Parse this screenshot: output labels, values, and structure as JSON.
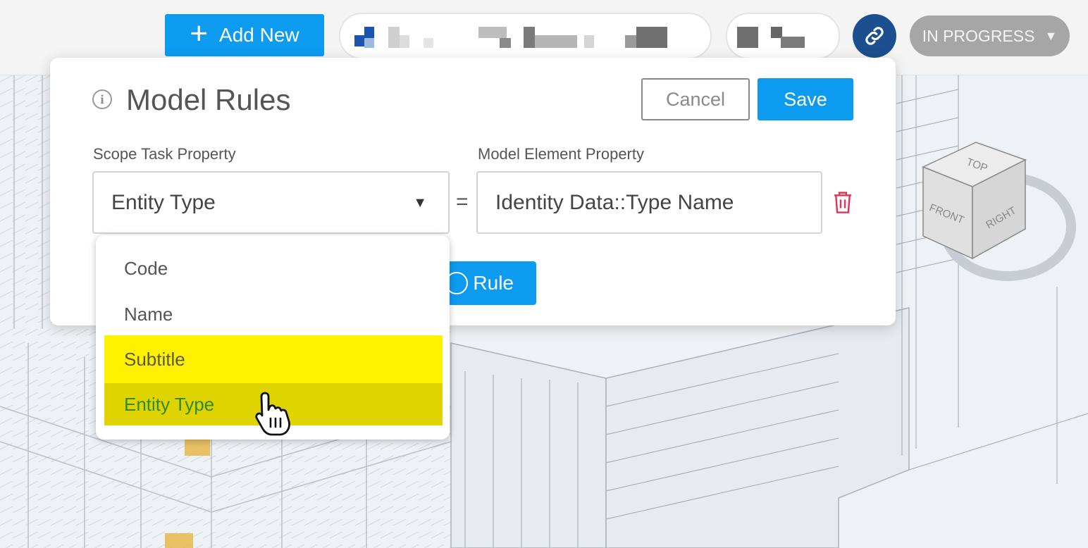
{
  "topbar": {
    "add_new_label": "Add New",
    "status_label": "IN PROGRESS",
    "colors": {
      "primary": "#0d9bf0",
      "link": "#1c4f8f",
      "status": "#a6a6a6"
    }
  },
  "modal": {
    "title": "Model Rules",
    "cancel_label": "Cancel",
    "save_label": "Save",
    "scope_label": "Scope Task Property",
    "model_label": "Model Element Property",
    "scope_value": "Entity Type",
    "equals": "=",
    "model_value": "Identity Data::Type Name",
    "add_rule_label": "Rule"
  },
  "dropdown": {
    "options": [
      "Code",
      "Name",
      "Subtitle",
      "Entity Type"
    ],
    "highlight_color": "#fff200",
    "hover_color": "#dfd400"
  },
  "viewcube": {
    "top": "TOP",
    "front": "FRONT",
    "right": "RIGHT"
  }
}
